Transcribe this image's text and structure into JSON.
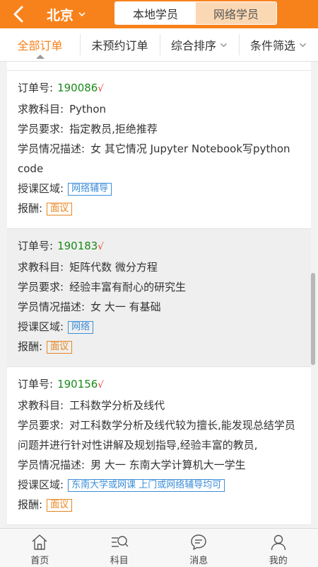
{
  "header": {
    "city": "北京",
    "tabs": [
      {
        "label": "本地学员",
        "active": true
      },
      {
        "label": "网络学员",
        "active": false
      }
    ],
    "accent": "#f7821b"
  },
  "filters": [
    {
      "label": "全部订单",
      "active": true
    },
    {
      "label": "未预约订单",
      "active": false
    },
    {
      "label": "综合排序",
      "active": false
    },
    {
      "label": "条件筛选",
      "active": false
    }
  ],
  "labels": {
    "order_no": "订单号:",
    "subject": "求教科目:",
    "requirement": "学员要求:",
    "description": "学员情况描述:",
    "area": "授课区域:",
    "pay": "报酬:",
    "check": "√"
  },
  "orders": [
    {
      "order_no": "190086",
      "subject": "Python",
      "requirement": "指定教员,拒绝推荐",
      "description": "女 其它情况 Jupyter Notebook写python code",
      "area": "网络辅导",
      "pay": "面议"
    },
    {
      "order_no": "190183",
      "subject": "矩阵代数 微分方程",
      "requirement": "经验丰富有耐心的研究生",
      "description": "女 大一 有基础",
      "area": "网络",
      "pay": "面议"
    },
    {
      "order_no": "190156",
      "subject": "工科数学分析及线代",
      "requirement": "对工科数学分析及线代较为擅长,能发现总结学员问题并进行针对性讲解及规划指导,经验丰富的教员,",
      "description": "男 大一 东南大学计算机大一学生",
      "area": "东南大学或网课 上门或网络辅导均可",
      "pay": "面议"
    }
  ],
  "tabbar": [
    {
      "label": "首页",
      "icon": "home-icon"
    },
    {
      "label": "科目",
      "icon": "subject-search-icon"
    },
    {
      "label": "消息",
      "icon": "message-icon"
    },
    {
      "label": "我的",
      "icon": "user-icon"
    }
  ]
}
